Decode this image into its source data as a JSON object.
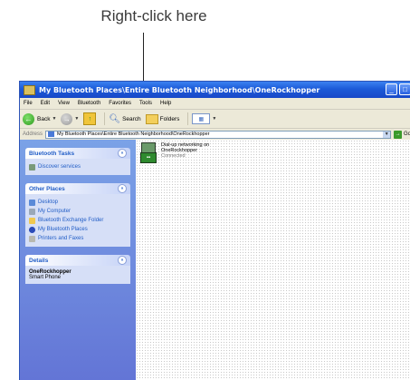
{
  "callout": {
    "text": "Right-click here"
  },
  "window": {
    "title": "My Bluetooth Places\\Entire Bluetooth Neighborhood\\OneRockhopper",
    "buttons": {
      "minimize": "_",
      "maximize": "□"
    }
  },
  "menu": [
    "File",
    "Edit",
    "View",
    "Bluetooth",
    "Favorites",
    "Tools",
    "Help"
  ],
  "toolbar": {
    "back_label": "Back",
    "search_label": "Search",
    "folders_label": "Folders"
  },
  "address": {
    "label": "Address",
    "value": "My Bluetooth Places\\Entire Bluetooth Neighborhood\\OneRockhopper",
    "go_label": "Go"
  },
  "tasks": {
    "bluetooth_tasks": {
      "title": "Bluetooth Tasks",
      "items": [
        "Discover services"
      ]
    },
    "other_places": {
      "title": "Other Places",
      "items": [
        "Desktop",
        "My Computer",
        "Bluetooth Exchange Folder",
        "My Bluetooth Places",
        "Printers and Faxes"
      ]
    },
    "details": {
      "title": "Details",
      "name": "OneRockhopper",
      "type": "Smart Phone"
    }
  },
  "file": {
    "line1": "Dial-up networking on",
    "line2": "OneRockhopper",
    "status": "Connected"
  }
}
